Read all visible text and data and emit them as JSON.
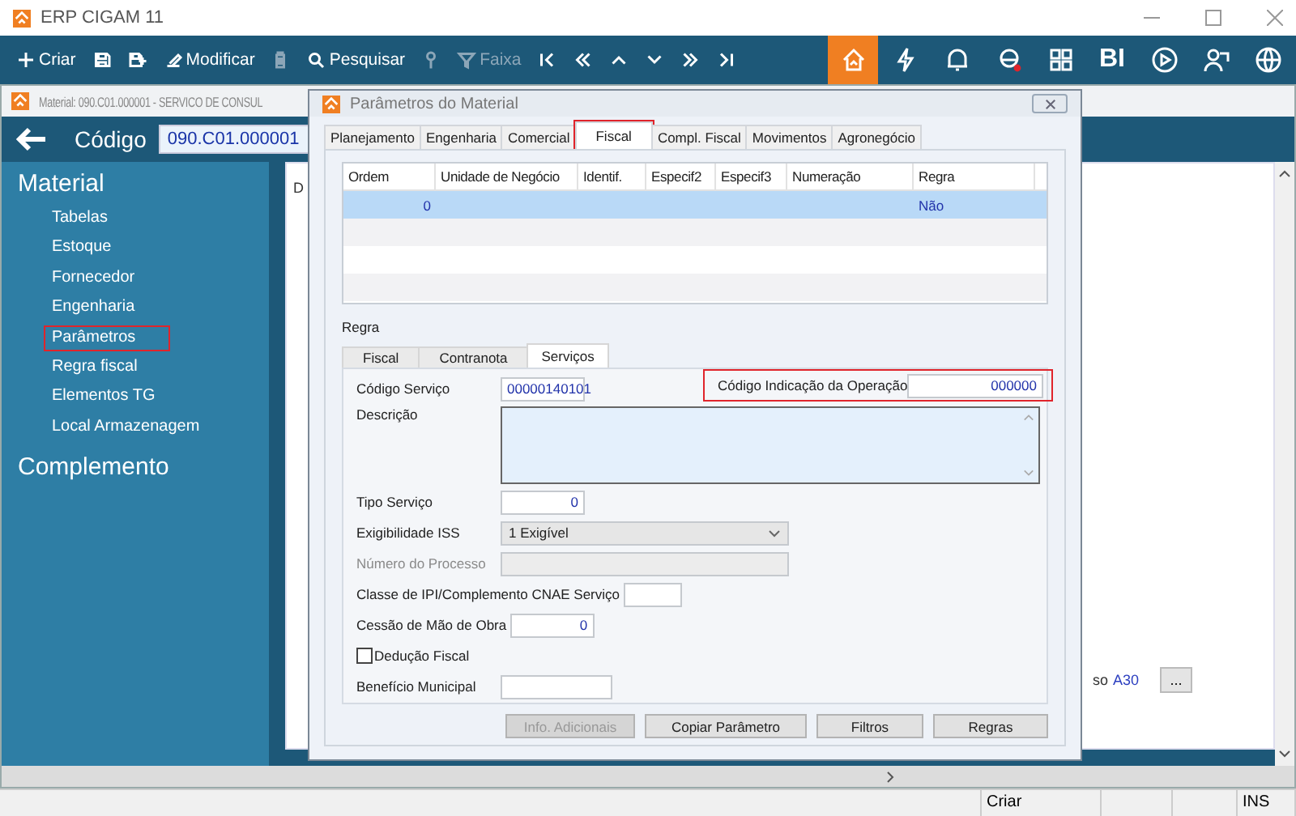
{
  "window": {
    "title": "ERP CIGAM 11"
  },
  "toolbar": {
    "left": [
      {
        "label": "Criar",
        "disabled": false
      },
      {
        "disabled": false
      },
      {
        "disabled": false
      },
      {
        "label": "Modificar",
        "disabled": false
      },
      {
        "disabled": true
      },
      {
        "label": "Pesquisar",
        "disabled": false
      },
      {
        "disabled": true
      },
      {
        "label": "Faixa",
        "disabled": true
      },
      {
        "disabled": false
      },
      {
        "disabled": false
      },
      {
        "disabled": false
      },
      {
        "disabled": false
      },
      {
        "disabled": false
      },
      {
        "disabled": false
      }
    ],
    "right": [
      {
        "selected": true
      },
      {
        "selected": false
      },
      {
        "selected": false
      },
      {
        "selected": false
      },
      {
        "selected": false
      },
      {
        "label": "BI",
        "selected": false
      },
      {
        "selected": false
      },
      {
        "selected": false
      },
      {
        "selected": false
      }
    ]
  },
  "material_window": {
    "title": "Material: 090.C01.000001 - SERVICO DE  CONSUL",
    "code_label": "Código",
    "code_value": "090.C01.000001",
    "sidebar": {
      "heading": "Material",
      "items": [
        {
          "label": "Tabelas",
          "highlighted": false
        },
        {
          "label": "Estoque",
          "highlighted": false
        },
        {
          "label": "Fornecedor",
          "highlighted": false
        },
        {
          "label": "Engenharia",
          "highlighted": false
        },
        {
          "label": "Parâmetros",
          "highlighted": true
        },
        {
          "label": "Regra fiscal",
          "highlighted": false
        },
        {
          "label": "Elementos TG",
          "highlighted": false
        },
        {
          "label": "Local Armazenagem",
          "highlighted": false
        }
      ],
      "footer_heading": "Complemento"
    },
    "content": {
      "tab": "D",
      "partial_label": "so",
      "value": "A30",
      "ellipsis_button": "..."
    }
  },
  "dialog": {
    "title": "Parâmetros do Material",
    "tabs": [
      {
        "label": "Planejamento",
        "selected": false,
        "highlighted": false
      },
      {
        "label": "Engenharia",
        "selected": false,
        "highlighted": false
      },
      {
        "label": "Comercial",
        "selected": false,
        "highlighted": false
      },
      {
        "label": "Fiscal",
        "selected": true,
        "highlighted": true
      },
      {
        "label": "Compl. Fiscal",
        "selected": false,
        "highlighted": false
      },
      {
        "label": "Movimentos",
        "selected": false,
        "highlighted": false
      },
      {
        "label": "Agronegócio",
        "selected": false,
        "highlighted": false
      }
    ],
    "table": {
      "columns": [
        "Ordem",
        "Unidade de Negócio",
        "Identif.",
        "Especif2",
        "Especif3",
        "Numeração",
        "Regra"
      ],
      "rows": [
        {
          "cells": [
            "0",
            "",
            "",
            "",
            "",
            "",
            "Não"
          ],
          "selected": true
        }
      ]
    },
    "section_label": "Regra",
    "subtabs": [
      {
        "label": "Fiscal",
        "selected": false
      },
      {
        "label": "Contranota",
        "selected": false
      },
      {
        "label": "Serviços",
        "selected": true
      }
    ],
    "operation_code": {
      "label": "Código Indicação da Operação",
      "value": "000000",
      "highlighted": true
    },
    "fields": [
      {
        "kind": "text",
        "label": "Código Serviço",
        "value": "00000140101",
        "disabled": false
      },
      {
        "kind": "textarea",
        "label": "Descrição",
        "disabled": false
      },
      {
        "kind": "number",
        "label": "Tipo Serviço",
        "value": "0",
        "disabled": false
      },
      {
        "kind": "select",
        "label": "Exigibilidade ISS",
        "value": "1 Exigível",
        "disabled": false
      },
      {
        "kind": "wide",
        "label": "Número do Processo",
        "disabled": true
      },
      {
        "kind": "short",
        "label": "Classe de IPI/Complemento CNAE Serviço",
        "disabled": false
      },
      {
        "kind": "number",
        "label": "Cessão de Mão de Obra",
        "value": "0",
        "disabled": false
      },
      {
        "kind": "checkbox",
        "label": "Dedução Fiscal",
        "checked": false,
        "disabled": false
      },
      {
        "kind": "medium",
        "label": "Benefício Municipal",
        "disabled": false
      }
    ],
    "buttons": [
      {
        "label": "Info. Adicionais",
        "disabled": true
      },
      {
        "label": "Copiar Parâmetro",
        "disabled": false
      },
      {
        "label": "Filtros",
        "disabled": false
      },
      {
        "label": "Regras",
        "disabled": false
      }
    ]
  },
  "status_bar": {
    "mode": "Criar",
    "insert": "INS"
  }
}
